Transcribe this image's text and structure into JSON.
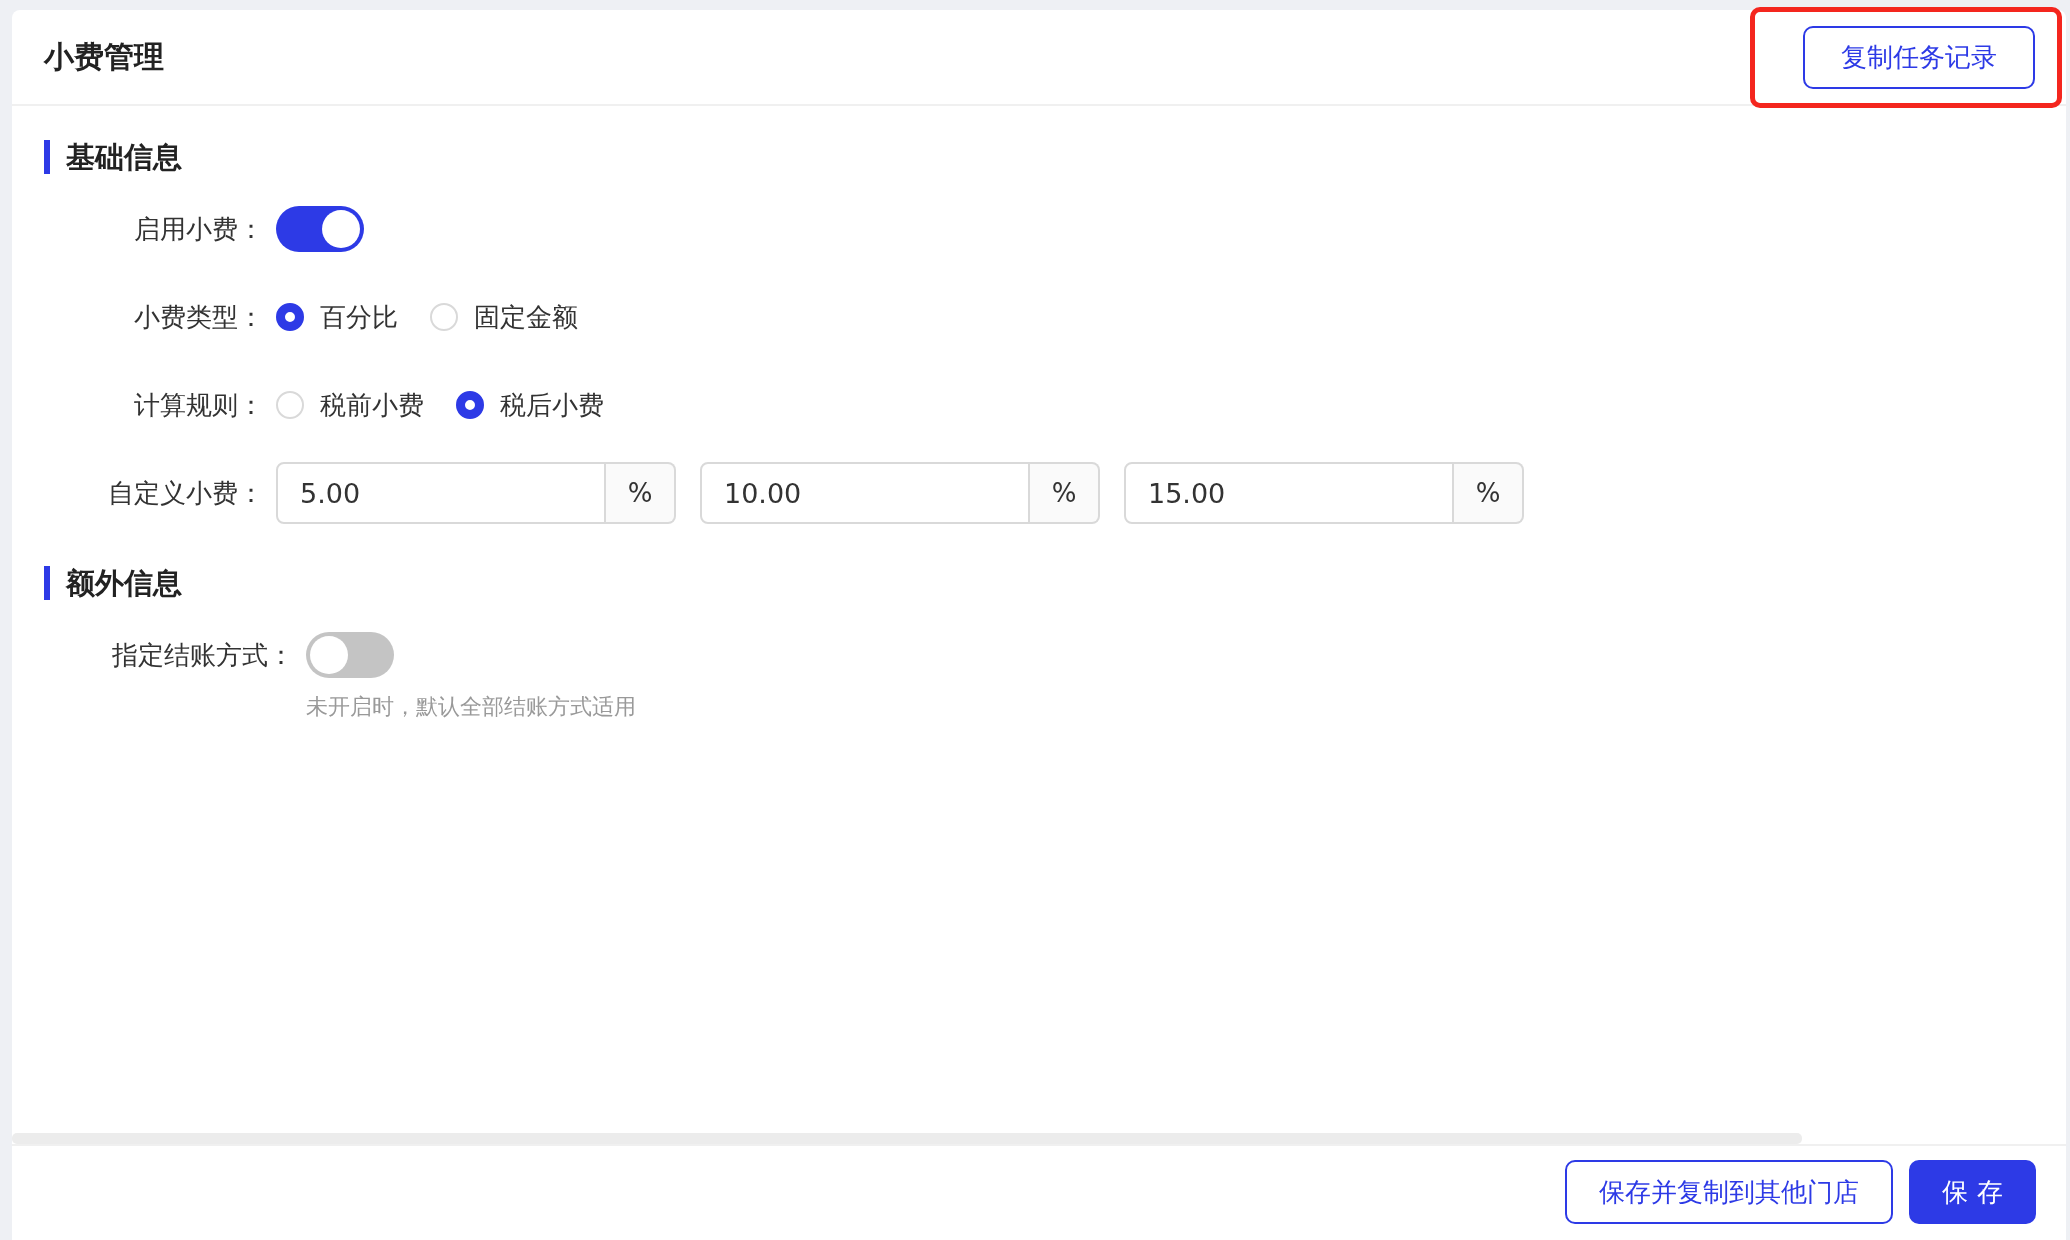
{
  "header": {
    "title": "小费管理",
    "copy_button": "复制任务记录"
  },
  "sections": [
    {
      "title": "基础信息",
      "fields": [
        {
          "kind": "switch",
          "label": "启用小费：",
          "on": true
        },
        {
          "kind": "radio",
          "label": "小费类型：",
          "options": [
            {
              "label": "百分比",
              "selected": true
            },
            {
              "label": "固定金额",
              "selected": false
            }
          ]
        },
        {
          "kind": "radio",
          "label": "计算规则：",
          "options": [
            {
              "label": "税前小费",
              "selected": false
            },
            {
              "label": "税后小费",
              "selected": true
            }
          ]
        },
        {
          "kind": "inputs",
          "label": "自定义小费：",
          "inputs": [
            {
              "value": "5.00",
              "suffix": "%"
            },
            {
              "value": "10.00",
              "suffix": "%"
            },
            {
              "value": "15.00",
              "suffix": "%"
            }
          ]
        }
      ]
    },
    {
      "title": "额外信息",
      "fields": [
        {
          "kind": "switch",
          "label": "指定结账方式：",
          "on": false,
          "hint": "未开启时，默认全部结账方式适用"
        }
      ]
    }
  ],
  "footer": {
    "buttons": [
      {
        "label": "保存并复制到其他门店",
        "kind": "outline"
      },
      {
        "label": "保 存",
        "kind": "primary"
      }
    ]
  }
}
